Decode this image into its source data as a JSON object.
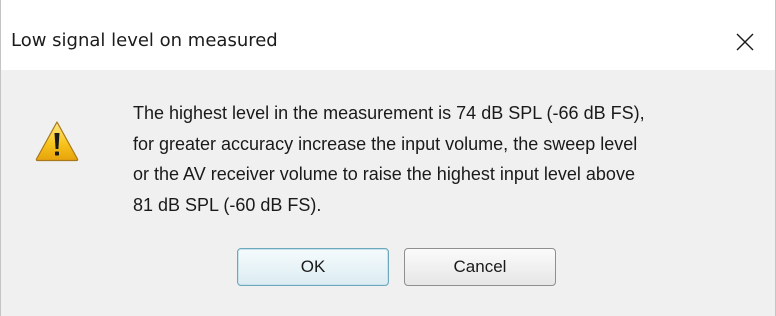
{
  "dialog": {
    "title": "Low signal level on measured",
    "close_icon": "close-icon",
    "icon": "warning-icon",
    "message_lines": [
      "The highest level in the measurement is 74 dB SPL (-66 dB FS),",
      "for greater accuracy increase the input volume, the sweep level",
      "or the AV receiver volume to raise the highest input level above",
      "81 dB SPL (-60 dB FS)."
    ],
    "ok_label": "OK",
    "cancel_label": "Cancel"
  },
  "colors": {
    "titlebar_bg": "#ffffff",
    "client_bg": "#f0f0f0",
    "default_button_border": "#6ea8bc",
    "warning_yellow": "#f7c51c"
  }
}
